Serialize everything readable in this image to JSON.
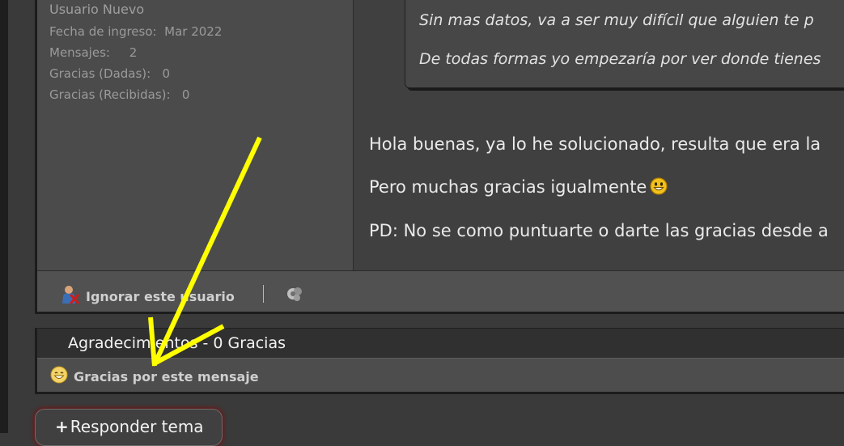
{
  "user_panel": {
    "rank": "Usuario Nuevo",
    "stats": [
      {
        "label": "Fecha de ingreso:",
        "value": "Mar 2022"
      },
      {
        "label": "Mensajes:",
        "value": "2"
      },
      {
        "label": "Gracias (Dadas):",
        "value": "0"
      },
      {
        "label": "Gracias (Recibidas):",
        "value": "0"
      }
    ]
  },
  "quote": {
    "lines": [
      "Sin mas datos, va a ser muy difícil que alguien te p",
      "De todas formas yo empezaría por ver donde tienes"
    ]
  },
  "message": {
    "lines": [
      "Hola buenas, ya lo he solucionado, resulta que era la",
      "Pero muchas gracias igualmente",
      "PD: No se como puntuarte o darte las gracias desde a"
    ],
    "smiley_icon": "smiley-face-icon"
  },
  "post_footer": {
    "ignore_label": "Ignorar este usuario",
    "ignore_icon": "user-block-icon",
    "report_icon": "report-icon"
  },
  "thanks_section": {
    "title": "Agradecimientos - 0 Gracias",
    "button_label": "Gracias por este mensaje",
    "button_icon": "thanks-smiley-icon"
  },
  "reply_button": {
    "plus": "+",
    "label": "Responder tema"
  },
  "annotation": {
    "arrow_color": "#ffff00"
  }
}
